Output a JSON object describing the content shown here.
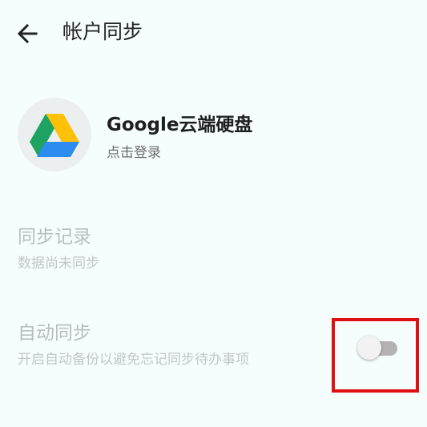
{
  "header": {
    "back_icon": "arrow-left-icon",
    "title": "帐户同步"
  },
  "account": {
    "icon": "google-drive-icon",
    "name": "Google云端硬盘",
    "subtitle": "点击登录"
  },
  "sync_record": {
    "title": "同步记录",
    "subtitle": "数据尚未同步"
  },
  "auto_sync": {
    "title": "自动同步",
    "subtitle": "开启自动备份以避免忘记同步待办事项",
    "enabled": false
  },
  "colors": {
    "background": "#f6fdfd",
    "highlight": "#e01010",
    "drive_green": "#1ea362",
    "drive_yellow": "#ffc107",
    "drive_blue": "#2d8cf0"
  }
}
